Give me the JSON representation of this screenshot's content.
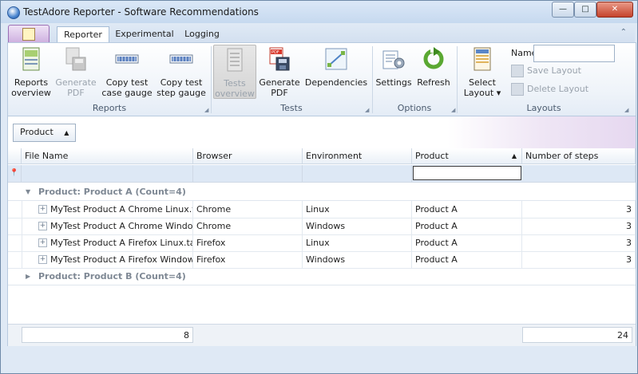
{
  "window": {
    "title": "TestAdore Reporter - Software Recommendations",
    "controls": {
      "minimize": "—",
      "maximize": "□",
      "close": "✕"
    }
  },
  "ribbon_tabs": [
    {
      "label": "Reporter",
      "active": true
    },
    {
      "label": "Experimental",
      "active": false
    },
    {
      "label": "Logging",
      "active": false
    }
  ],
  "ribbon": {
    "groups": {
      "reports": {
        "label": "Reports",
        "buttons": {
          "reports_overview": {
            "line1": "Reports",
            "line2": "overview",
            "icon": "reports-overview-icon"
          },
          "generate_pdf": {
            "line1": "Generate",
            "line2": "PDF",
            "icon": "pdf-icon",
            "disabled": true
          },
          "copy_case_gauge": {
            "line1": "Copy test",
            "line2": "case gauge",
            "icon": "gauge-icon"
          },
          "copy_step_gauge": {
            "line1": "Copy test",
            "line2": "step gauge",
            "icon": "gauge-icon"
          }
        }
      },
      "tests": {
        "label": "Tests",
        "buttons": {
          "tests_overview": {
            "line1": "Tests",
            "line2": "overview",
            "icon": "tests-overview-icon",
            "disabled": true,
            "pressed": true
          },
          "generate_pdf": {
            "line1": "Generate",
            "line2": "PDF",
            "icon": "pdf-icon"
          },
          "dependencies": {
            "line1": "Dependencies",
            "line2": "",
            "icon": "dependencies-icon"
          }
        }
      },
      "options": {
        "label": "Options",
        "buttons": {
          "settings": {
            "line1": "Settings",
            "line2": "",
            "icon": "settings-icon"
          },
          "refresh": {
            "line1": "Refresh",
            "line2": "",
            "icon": "refresh-icon"
          }
        }
      },
      "layouts": {
        "label": "Layouts",
        "select_layout": {
          "line1": "Select",
          "line2": "Layout",
          "icon": "select-layout-icon"
        },
        "name_label": "Name",
        "name_value": "",
        "save_layout": "Save Layout",
        "delete_layout": "Delete Layout"
      }
    }
  },
  "grid": {
    "group_by_chip": "Product",
    "columns": [
      "File Name",
      "Browser",
      "Environment",
      "Product",
      "Number of steps"
    ],
    "groups": [
      {
        "label": "Product: Product A (Count=4)",
        "expanded": true,
        "rows": [
          {
            "file": "MyTest Product A Chrome Linux.ta",
            "browser": "Chrome",
            "environment": "Linux",
            "product": "Product A",
            "steps": "3"
          },
          {
            "file": "MyTest Product A Chrome Windo…",
            "browser": "Chrome",
            "environment": "Windows",
            "product": "Product A",
            "steps": "3"
          },
          {
            "file": "MyTest Product A Firefox Linux.ta",
            "browser": "Firefox",
            "environment": "Linux",
            "product": "Product A",
            "steps": "3"
          },
          {
            "file": "MyTest Product A Firefox Window…",
            "browser": "Firefox",
            "environment": "Windows",
            "product": "Product A",
            "steps": "3"
          }
        ]
      },
      {
        "label": "Product: Product B (Count=4)",
        "expanded": false,
        "rows": []
      }
    ],
    "footer": {
      "file_count": "8",
      "steps_total": "24"
    }
  }
}
